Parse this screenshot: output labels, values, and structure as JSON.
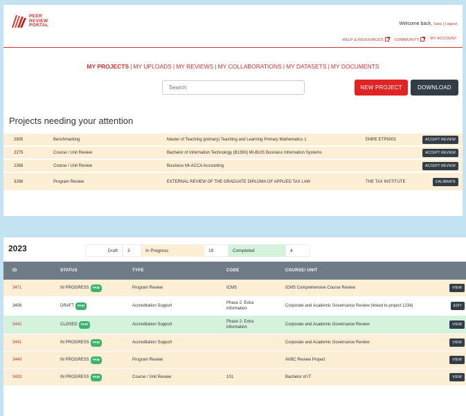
{
  "brand": {
    "line1": "PEER",
    "line2": "REVIEW",
    "line3": "PORTAL",
    "logo_icon": "book-stack-logo-icon",
    "color": "#d22e2a"
  },
  "header": {
    "welcome": "Welcome back,",
    "user": "Sara",
    "separator": "|",
    "logout": "Logout",
    "links": [
      {
        "label": "HELP & RESOURCES",
        "icon": "external-link-icon"
      },
      {
        "label": "COMMUNITY",
        "icon": "external-link-icon"
      },
      {
        "label": "MY ACCOUNT"
      }
    ]
  },
  "nav": {
    "items": [
      "MY PROJECTS",
      "MY UPLOADS",
      "MY REVIEWS",
      "MY COLLABORATIONS",
      "MY DATASETS",
      "MY DOCUMENTS"
    ],
    "active": "MY PROJECTS"
  },
  "toolbar": {
    "search_placeholder": "Search",
    "new_project": "NEW PROJECT",
    "download": "DOWNLOAD"
  },
  "attention": {
    "title": "Projects needing your attention",
    "rows": [
      {
        "id": "2805",
        "type": "Benchmarking",
        "course": "Master of Teaching (primary) Teaching and Learning Primary Mathematics 1",
        "code": "EMPE ETP5003",
        "action": "ACCEPT REVIEW"
      },
      {
        "id": "2275",
        "type": "Course / Unit Review",
        "course": "Bachelor of Information Technology (B1390) MI-BUIS Business Information Systems",
        "code": "",
        "action": "ACCEPT REVIEW"
      },
      {
        "id": "2266",
        "type": "Course / Unit Review",
        "course": "Business MI-ACCA Accounting",
        "code": "",
        "action": "ACCEPT REVIEW"
      },
      {
        "id": "3268",
        "type": "Program Review",
        "course": "EXTERNAL REVIEW OF THE GRADUATE DIPLOMA OF APPLIED TAX LAW",
        "code": "THE TAX INSTITUTE",
        "action": "CALIBRATE"
      }
    ]
  },
  "year_section": {
    "year": "2023",
    "counts": {
      "draft_label": "Draft",
      "draft_value": "3",
      "progress_label": "In Progress",
      "progress_value": "19",
      "completed_label": "Completed",
      "completed_value": "4"
    },
    "columns": [
      "ID",
      "STATUS",
      "TYPE",
      "CODE",
      "COURSE/ UNIT"
    ],
    "paid_label": "PAID",
    "rows": [
      {
        "id": "3471",
        "status": "IN PROGRESS",
        "type": "Program Review",
        "code": "ICMS",
        "course": "ICMS Comprehensive Course Review",
        "action": "VIEW",
        "tone": "orange"
      },
      {
        "id": "3456",
        "status": "DRAFT",
        "type": "Accreditation Support",
        "code": "Phase 2: Extra information",
        "course": "Corporate and Academic Governance Review (linked to project 1234)",
        "action": "EDIT",
        "tone": "white"
      },
      {
        "id": "3442",
        "status": "CLOSED",
        "type": "Accreditation Support",
        "code": "Phase 2: Extra information",
        "course": "Corporate and Academic Governance Review",
        "action": "VIEW",
        "tone": "green"
      },
      {
        "id": "3441",
        "status": "IN PROGRESS",
        "type": "Accreditation Support",
        "code": "",
        "course": "Corporate and Academic Governance Review",
        "action": "VIEW",
        "tone": "orange"
      },
      {
        "id": "3440",
        "status": "IN PROGRESS",
        "type": "Program Review",
        "code": "",
        "course": "AVBC Review Project",
        "action": "VIEW",
        "tone": "orange"
      },
      {
        "id": "3433",
        "status": "IN PROGRESS",
        "type": "Course / Unit Review",
        "code": "101",
        "course": "Bachelor of IT",
        "action": "VIEW",
        "tone": "orange"
      }
    ]
  },
  "colors": {
    "accent": "#d0312d",
    "button_red": "#e02323",
    "button_dark": "#333d45",
    "row_orange": "#fdefd6",
    "row_green": "#d4f2dc",
    "table_header": "#6f7b87",
    "paid_green": "#3cb371",
    "background": "#c4e3f2"
  }
}
